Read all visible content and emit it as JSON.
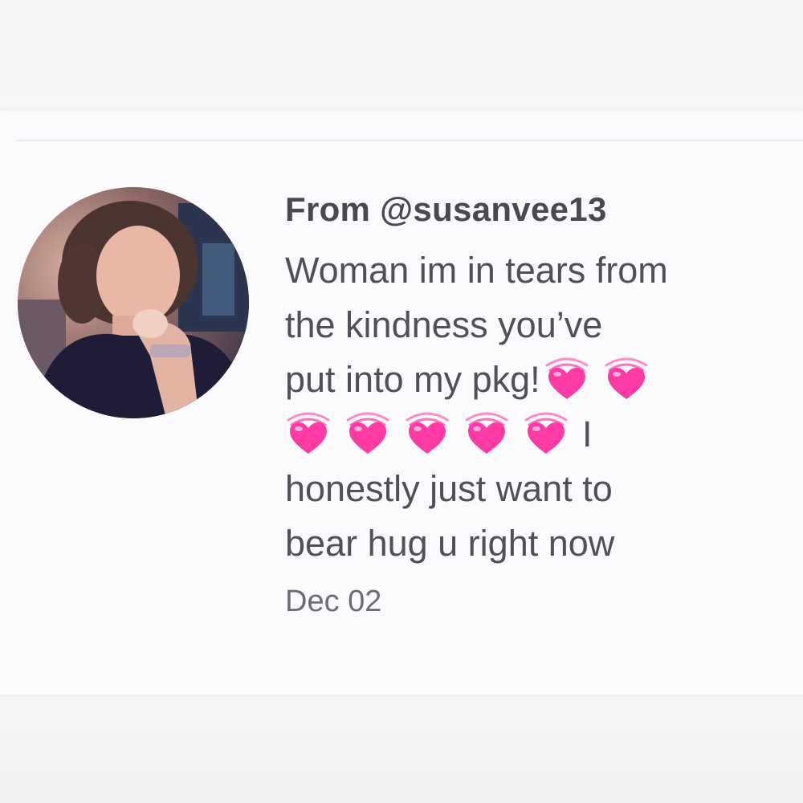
{
  "comment": {
    "from_label": "From @susanvee13",
    "message_lines": [
      "Woman im in tears from",
      "the kindness you’ve",
      "put into my pkg!",
      "I",
      "honestly just want to",
      "bear hug u right now"
    ],
    "emoji_name": "growing-heart",
    "date": "Dec 02"
  },
  "colors": {
    "heart": "#ff3aa5",
    "heart_wave": "#ff71c0",
    "text": "#4e4c50",
    "date": "#6e6c70"
  }
}
